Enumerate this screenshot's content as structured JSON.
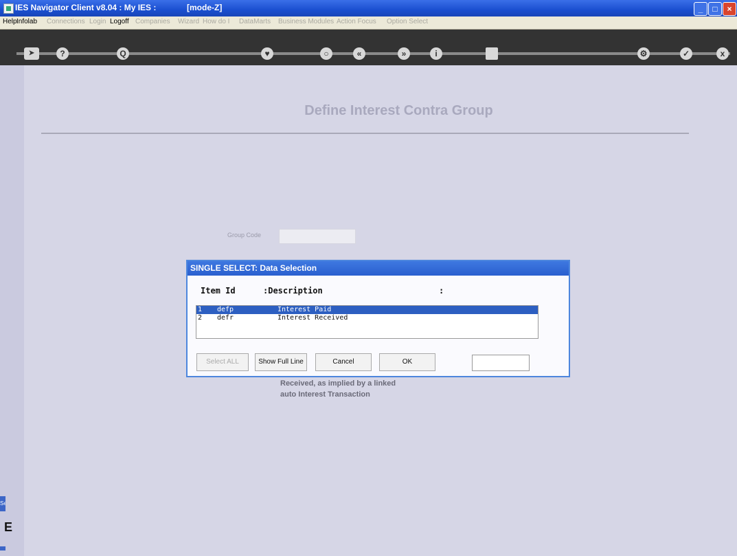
{
  "window": {
    "title": "IES Navigator Client v8.04 : My IES :",
    "mode": "[mode-Z]"
  },
  "menu": [
    {
      "label": "Help",
      "enabled": true
    },
    {
      "label": "Infolab",
      "enabled": true
    },
    {
      "label": "Connections",
      "enabled": false
    },
    {
      "label": "Login",
      "enabled": false
    },
    {
      "label": "Logoff",
      "enabled": true
    },
    {
      "label": "Companies",
      "enabled": false
    },
    {
      "label": "Wizard",
      "enabled": false
    },
    {
      "label": "How do I",
      "enabled": false
    },
    {
      "label": "DataMarts",
      "enabled": false
    },
    {
      "label": "Business Modules",
      "enabled": false
    },
    {
      "label": "Action Focus",
      "enabled": false
    },
    {
      "label": "Option Select",
      "enabled": false
    }
  ],
  "toolbar": {
    "help_icon_glyph": "?",
    "search_icon_glyph": "Q",
    "back_glyph": "«",
    "forward_glyph": "»",
    "info_glyph": "i",
    "ok_glyph": "✓",
    "close_glyph": "x"
  },
  "form": {
    "title": "Define Interest Contra Group",
    "group_code_label": "Group Code",
    "group_code_value": "",
    "help_text_line1": "Received, as implied by a linked",
    "help_text_line2": "auto Interest Transaction"
  },
  "dialog": {
    "title": "SINGLE SELECT: Data Selection",
    "col_item_id": "Item Id",
    "col_description": ":Description",
    "col_extra": ":",
    "rows": [
      {
        "num": "1",
        "id": "defp",
        "desc": "Interest Paid",
        "selected": true
      },
      {
        "num": "2",
        "id": "defr",
        "desc": "Interest Received",
        "selected": false
      }
    ],
    "buttons": {
      "select_all": "Select ALL",
      "show_full_line": "Show Full Line",
      "cancel": "Cancel",
      "ok": "OK"
    },
    "search_value": ""
  },
  "sidebar": {
    "tab_label": "Ser",
    "glyph": "E"
  },
  "colors": {
    "titlebar": "#1b4fd0",
    "background": "#d6d6e6",
    "selection": "#2d5fc1"
  }
}
